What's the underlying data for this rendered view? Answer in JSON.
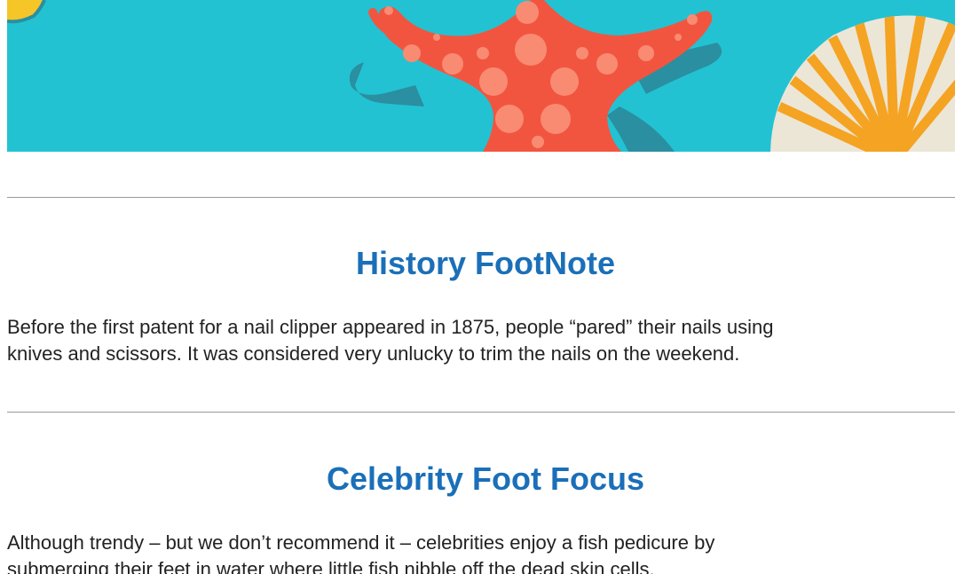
{
  "banner": {
    "description_icons": [
      "sun-icon",
      "starfish-icon",
      "seashell-icon"
    ],
    "colors": {
      "water": "#22c2d3",
      "starfish": "#f2553f",
      "starfish_spots": "#f98b72",
      "shadow": "#2a8fa0",
      "shell_orange": "#f5a322",
      "shell_cream": "#ece6d6",
      "sun": "#f6c528"
    }
  },
  "sections": [
    {
      "title": "History FootNote",
      "body_line1": "Before the first patent for a nail clipper appeared in 1875, people “pared” their nails using",
      "body_line2": "knives and scissors. It was considered very unlucky to trim the nails on the weekend."
    },
    {
      "title": "Celebrity Foot Focus",
      "body_line1": "Although trendy – but we don’t recommend it – celebrities enjoy a fish pedicure by",
      "body_line2": "submerging their feet in water where little fish nibble off the dead skin cells."
    }
  ],
  "colors": {
    "heading": "#1b6fb8",
    "body_text": "#222222",
    "divider": "#999999"
  }
}
